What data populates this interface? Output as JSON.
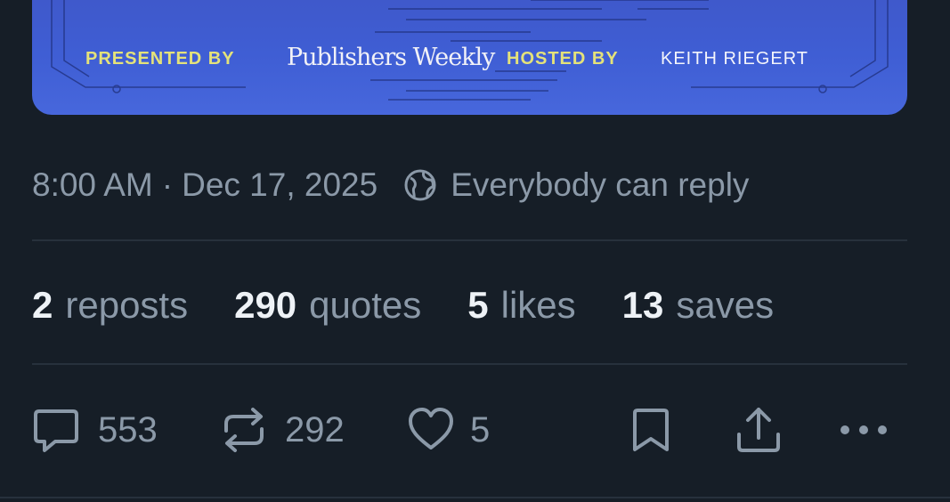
{
  "banner": {
    "presented_label": "PRESENTED BY",
    "sponsor_logo_text": "Publishers Weekly",
    "hosted_label": "HOSTED BY",
    "host_name": "KEITH RIEGERT",
    "colors": {
      "background": "#4060d0",
      "label_accent": "#e4e27a"
    }
  },
  "post_meta": {
    "time": "8:00 AM",
    "separator": "·",
    "date": "Dec 17, 2025",
    "reply_setting": "Everybody can reply",
    "reply_icon": "globe-icon"
  },
  "stats": [
    {
      "count": "2",
      "label": "reposts"
    },
    {
      "count": "290",
      "label": "quotes"
    },
    {
      "count": "5",
      "label": "likes"
    },
    {
      "count": "13",
      "label": "saves"
    }
  ],
  "actions": {
    "reply": {
      "icon": "comment-icon",
      "count": "553"
    },
    "repost": {
      "icon": "repost-icon",
      "count": "292"
    },
    "like": {
      "icon": "heart-icon",
      "count": "5"
    },
    "bookmark": {
      "icon": "bookmark-icon"
    },
    "share": {
      "icon": "share-icon"
    },
    "more": {
      "icon": "more-icon"
    }
  },
  "colors": {
    "background": "#161e27",
    "muted_text": "#8b99a8",
    "primary_text": "#eef2f6",
    "divider": "#27313c"
  }
}
